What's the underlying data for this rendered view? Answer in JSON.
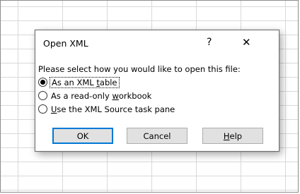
{
  "dialog": {
    "title": "Open XML",
    "help_glyph": "?",
    "close_glyph": "✕",
    "prompt": "Please select how you would like to open this file:",
    "options": [
      {
        "before": "As an XML ",
        "mnemonic": "t",
        "after": "able",
        "selected": true
      },
      {
        "before": "As a read-only ",
        "mnemonic": "w",
        "after": "orkbook",
        "selected": false
      },
      {
        "before": "",
        "mnemonic": "U",
        "after": "se the XML Source task pane",
        "selected": false
      }
    ],
    "buttons": {
      "ok": "OK",
      "cancel": "Cancel",
      "help_mnemonic": "H",
      "help_rest": "elp"
    }
  }
}
